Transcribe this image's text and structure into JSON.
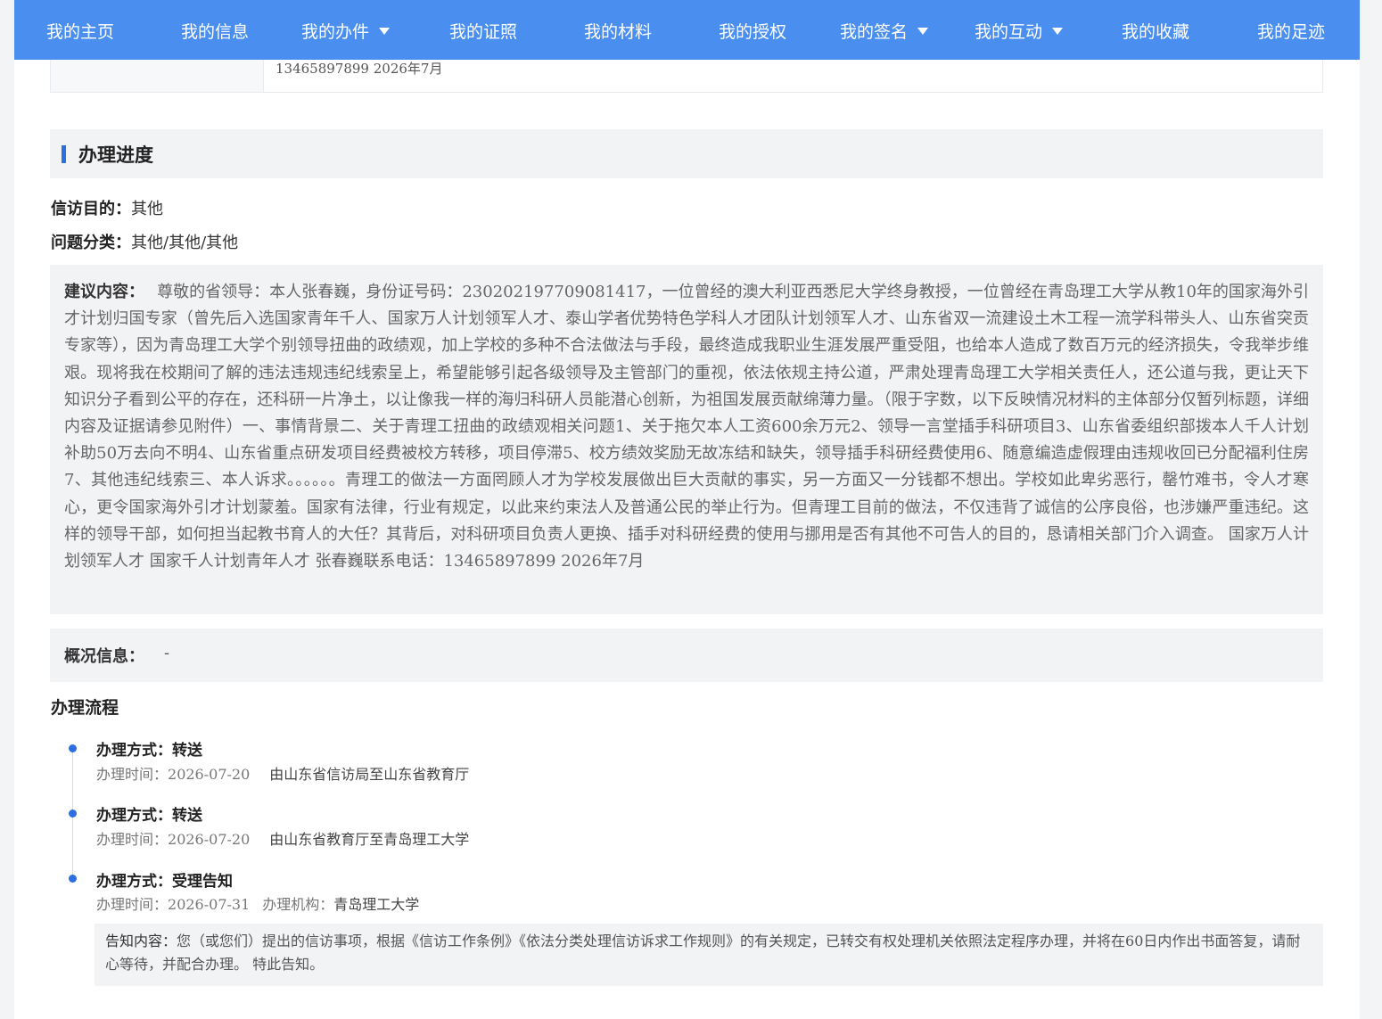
{
  "nav": {
    "items": [
      {
        "label": "我的主页",
        "dropdown": false
      },
      {
        "label": "我的信息",
        "dropdown": false
      },
      {
        "label": "我的办件",
        "dropdown": true
      },
      {
        "label": "我的证照",
        "dropdown": false
      },
      {
        "label": "我的材料",
        "dropdown": false
      },
      {
        "label": "我的授权",
        "dropdown": false
      },
      {
        "label": "我的签名",
        "dropdown": true
      },
      {
        "label": "我的互动",
        "dropdown": true
      },
      {
        "label": "我的收藏",
        "dropdown": false
      },
      {
        "label": "我的足迹",
        "dropdown": false
      }
    ]
  },
  "prev_row": {
    "value": "13465897899 2026年7月"
  },
  "progress": {
    "title": "办理进度",
    "purpose_label": "信访目的：",
    "purpose_value": "其他",
    "category_label": "问题分类：",
    "category_value": "其他/其他/其他",
    "suggestion_label": "建议内容：",
    "suggestion_text": "尊敬的省领导：本人张春巍，身份证号码：230202197709081417，一位曾经的澳大利亚西悉尼大学终身教授，一位曾经在青岛理工大学从教10年的国家海外引才计划归国专家（曾先后入选国家青年千人、国家万人计划领军人才、泰山学者优势特色学科人才团队计划领军人才、山东省双一流建设土木工程一流学科带头人、山东省突贡专家等），因为青岛理工大学个别领导扭曲的政绩观，加上学校的多种不合法做法与手段，最终造成我职业生涯发展严重受阻，也给本人造成了数百万元的经济损失，令我举步维艰。现将我在校期间了解的违法违规违纪线索呈上，希望能够引起各级领导及主管部门的重视，依法依规主持公道，严肃处理青岛理工大学相关责任人，还公道与我，更让天下知识分子看到公平的存在，还科研一片净土，以让像我一样的海归科研人员能潜心创新，为祖国发展贡献绵薄力量。（限于字数，以下反映情况材料的主体部分仅暂列标题，详细内容及证据请参见附件）一、事情背景二、关于青理工扭曲的政绩观相关问题1、关于拖欠本人工资600余万元2、领导一言堂插手科研项目3、山东省委组织部拨本人千人计划补助50万去向不明4、山东省重点研发项目经费被校方转移，项目停滞5、校方绩效奖励无故冻结和缺失，领导插手科研经费使用6、随意编造虚假理由违规收回已分配福利住房7、其他违纪线索三、本人诉求。。。。。。青理工的做法一方面罔顾人才为学校发展做出巨大贡献的事实，另一方面又一分钱都不想出。学校如此卑劣恶行，罄竹难书，令人才寒心，更令国家海外引才计划蒙羞。国家有法律，行业有规定，以此来约束法人及普通公民的举止行为。但青理工目前的做法，不仅违背了诚信的公序良俗，也涉嫌严重违纪。这样的领导干部，如何担当起教书育人的大任？其背后，对科研项目负责人更换、插手对科研经费的使用与挪用是否有其他不可告人的目的，恳请相关部门介入调查。 国家万人计划领军人才 国家千人计划青年人才 张春巍联系电话：13465897899 2026年7月",
    "overview_label": "概况信息：",
    "overview_value": "-"
  },
  "flow": {
    "title": "办理流程",
    "steps": [
      {
        "method": "办理方式：转送",
        "time_label": "办理时间：",
        "time": "2026-07-20",
        "desc": "由山东省信访局至山东省教育厅"
      },
      {
        "method": "办理方式：转送",
        "time_label": "办理时间：",
        "time": "2026-07-20",
        "desc": "由山东省教育厅至青岛理工大学"
      },
      {
        "method": "办理方式：受理告知",
        "time_label": "办理时间：",
        "time": "2026-07-31",
        "org_label": "办理机构：",
        "org": "青岛理工大学",
        "notice_label": "告知内容：",
        "notice_text": "您（或您们）提出的信访事项，根据《信访工作条例》《依法分类处理信访诉求工作规则》的有关规定，已转交有权处理机关依照法定程序办理，并将在60日内作出书面答复，请耐心等待，并配合办理。 特此告知。"
      }
    ]
  },
  "colors": {
    "nav_bg": "#4a8ff0",
    "accent": "#2b6fe0",
    "panel_bg": "#f2f3f5"
  }
}
